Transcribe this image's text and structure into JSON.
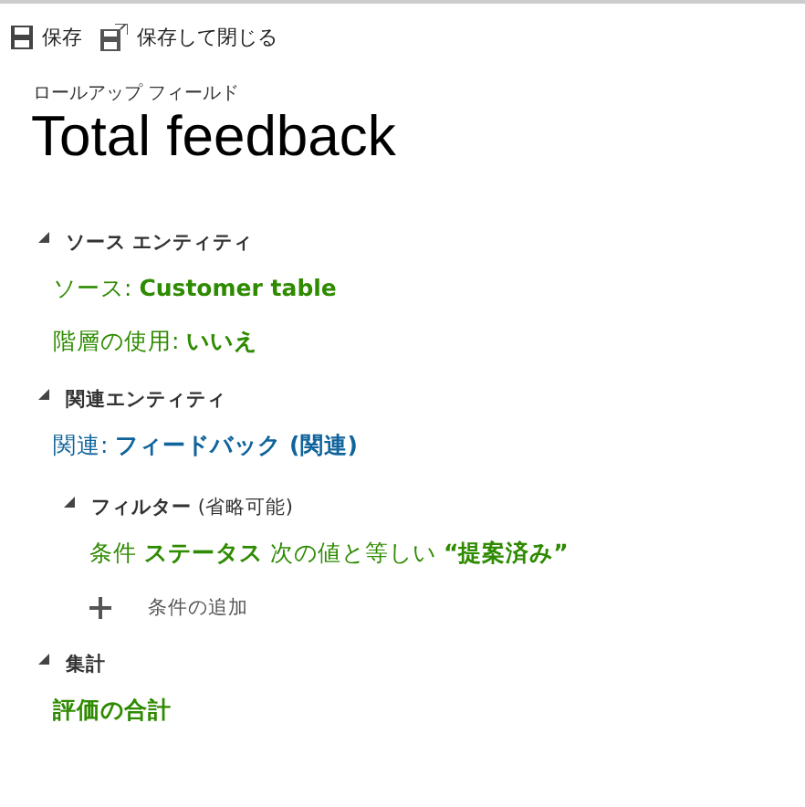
{
  "toolbar": [
    {
      "kind": "save",
      "label": "保存"
    },
    {
      "kind": "save-close",
      "label": "保存して閉じる"
    }
  ],
  "subtitle": "ロールアップ フィールド",
  "title": "Total feedback",
  "sections": [
    {
      "heading": "ソース エンティティ",
      "expanded": true,
      "items": [
        {
          "kind": "value",
          "label": "ソース: ",
          "value": "Customer table",
          "color": "#2e8b00"
        },
        {
          "kind": "value",
          "label": "階層の使用: ",
          "value": "いいえ",
          "color": "#2e8b00"
        }
      ]
    },
    {
      "heading": "関連エンティティ",
      "expanded": true,
      "items": [
        {
          "kind": "value",
          "label": "関連: ",
          "value": "フィードバック (関連)",
          "color": "#10649c"
        }
      ],
      "subsections": [
        {
          "heading": "フィルター",
          "note": " (省略可能)",
          "expanded": true,
          "items": [
            {
              "kind": "rich",
              "text": "条件 **ステータス** 次の値と等しい **“提案済み”**",
              "color": "#2e8b00"
            },
            {
              "kind": "add",
              "label": "条件の追加"
            }
          ]
        }
      ]
    },
    {
      "heading": "集計",
      "expanded": true,
      "items": [
        {
          "kind": "rich",
          "text": "**評価の合計**",
          "color": "#2e8b00"
        }
      ]
    }
  ]
}
